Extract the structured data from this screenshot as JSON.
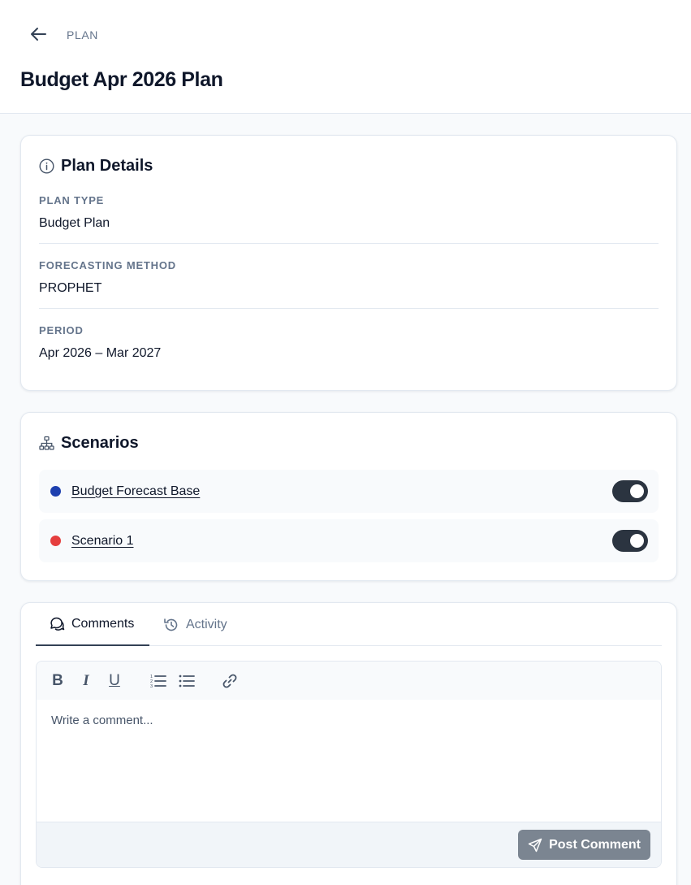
{
  "header": {
    "breadcrumb": "PLAN",
    "title": "Budget Apr 2026 Plan"
  },
  "details": {
    "title": "Plan Details",
    "icon": "info-icon",
    "fields": [
      {
        "label": "PLAN TYPE",
        "value": "Budget Plan"
      },
      {
        "label": "FORECASTING METHOD",
        "value": "PROPHET"
      },
      {
        "label": "PERIOD",
        "value": "Apr 2026 – Mar 2027"
      }
    ]
  },
  "scenarios": {
    "title": "Scenarios",
    "icon": "hierarchy-icon",
    "items": [
      {
        "name": "Budget Forecast Base",
        "color": "#1e40af",
        "enabled": true
      },
      {
        "name": "Scenario 1",
        "color": "#e53e3e",
        "enabled": true
      }
    ]
  },
  "comments": {
    "tabs": [
      {
        "label": "Comments",
        "icon": "chat-bubbles-icon",
        "active": true
      },
      {
        "label": "Activity",
        "icon": "history-icon",
        "active": false
      }
    ],
    "toolbar": [
      "bold",
      "italic",
      "underline",
      "ordered-list",
      "bullet-list",
      "link"
    ],
    "placeholder": "Write a comment...",
    "post_label": "Post Comment"
  },
  "colors": {
    "accent_dark": "#2b3440",
    "post_button": "#7b8591",
    "muted_text": "#64748b"
  }
}
